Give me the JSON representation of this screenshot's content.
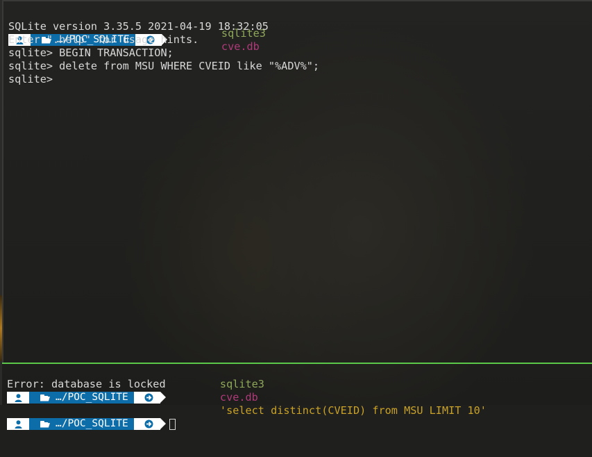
{
  "theme": {
    "prompt_user_bg": "#ffffff",
    "prompt_dir_bg": "#0d6da8",
    "cmd_color": "#8fa85a",
    "arg_color": "#b03a7a",
    "string_color": "#c9a227",
    "active_pane_border": "#5cc84a"
  },
  "prompt": {
    "dir": "…/POC_SQLITE",
    "user_icon": "user-icon",
    "folder_icon": "folder-open-icon",
    "status_icon": "arrow-circle-right-icon"
  },
  "top_pane": {
    "command": {
      "program": "sqlite3",
      "arg": "cve.db"
    },
    "output": [
      "SQLite version 3.35.5 2021-04-19 18:32:05",
      "Enter \".help\" for usage hints.",
      "sqlite> BEGIN TRANSACTION;",
      "sqlite> delete from MSU WHERE CVEID like \"%ADV%\";",
      "sqlite>"
    ]
  },
  "bottom_pane": {
    "command": {
      "program": "sqlite3",
      "arg": "cve.db",
      "query": "'select distinct(CVEID) from MSU LIMIT 10'"
    },
    "output": [
      "Error: database is locked"
    ]
  }
}
